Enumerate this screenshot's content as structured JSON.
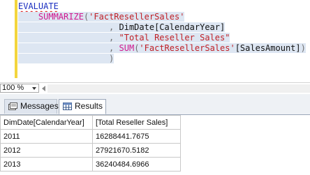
{
  "editor": {
    "lines": [
      [
        {
          "t": "EVALUATE",
          "c": "kw squiggle"
        }
      ],
      [
        {
          "t": "    ",
          "c": "txt"
        },
        {
          "t": "SUMMARIZE",
          "c": "fn"
        },
        {
          "t": "(",
          "c": "gray"
        },
        {
          "t": "'FactResellerSales'",
          "c": "str"
        }
      ],
      [
        {
          "t": "                  , ",
          "c": "gray"
        },
        {
          "t": "DimDate[CalendarYear]",
          "c": "txt"
        }
      ],
      [
        {
          "t": "                  , ",
          "c": "gray"
        },
        {
          "t": "\"Total Reseller Sales\"",
          "c": "str"
        }
      ],
      [
        {
          "t": "                  , ",
          "c": "gray"
        },
        {
          "t": "SUM",
          "c": "fn"
        },
        {
          "t": "(",
          "c": "gray"
        },
        {
          "t": "'FactResellerSales'",
          "c": "str"
        },
        {
          "t": "[SalesAmount]",
          "c": "txt"
        },
        {
          "t": ")",
          "c": "gray"
        }
      ],
      [
        {
          "t": "                  )",
          "c": "gray"
        }
      ]
    ]
  },
  "zoom": {
    "value": "100 %"
  },
  "tabs": {
    "messages": "Messages",
    "results": "Results"
  },
  "grid": {
    "headers": [
      "DimDate[CalendarYear]",
      "[Total Reseller Sales]"
    ],
    "rows": [
      [
        "2011",
        "16288441.7675"
      ],
      [
        "2012",
        "27921670.5182"
      ],
      [
        "2013",
        "36240484.6966"
      ]
    ]
  }
}
